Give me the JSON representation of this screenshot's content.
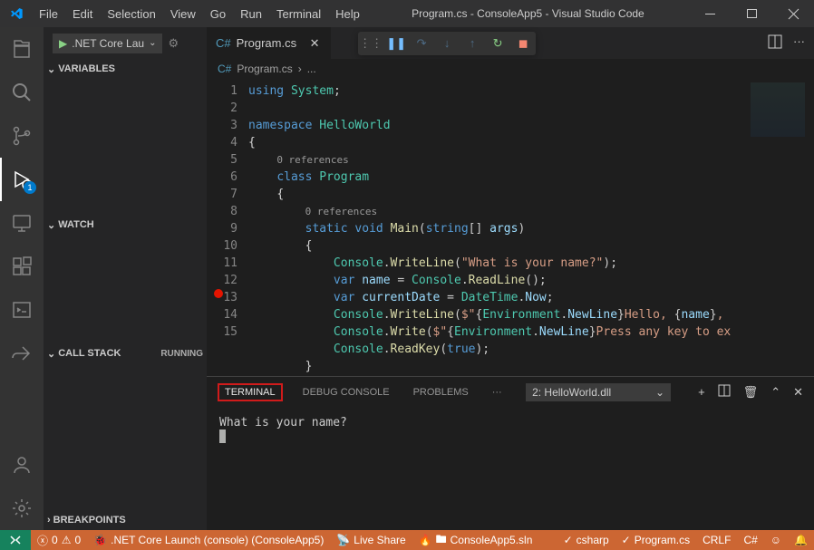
{
  "titlebar": {
    "menu": [
      "File",
      "Edit",
      "Selection",
      "View",
      "Go",
      "Run",
      "Terminal",
      "Help"
    ],
    "title": "Program.cs - ConsoleApp5 - Visual Studio Code"
  },
  "activitybar": {
    "debug_badge": "1"
  },
  "sidebar": {
    "run_config": ".NET Core Lau",
    "sections": {
      "variables": "VARIABLES",
      "watch": "WATCH",
      "callstack": "CALL STACK",
      "callstack_state": "RUNNING",
      "breakpoints": "BREAKPOINTS"
    }
  },
  "editor": {
    "tab_name": "Program.cs",
    "breadcrumb_file": "Program.cs",
    "breadcrumb_suffix": "...",
    "lines": [
      "1",
      "2",
      "3",
      "4",
      "",
      "5",
      "6",
      "",
      "7",
      "8",
      "9",
      "10",
      "11",
      "12",
      "13",
      "14",
      "15"
    ],
    "breakpoint_line": 12,
    "code": {
      "l1_using": "using",
      "l1_system": "System",
      "l3_namespace": "namespace",
      "l3_name": "HelloWorld",
      "codelens": "0 references",
      "l5_class": "class",
      "l5_name": "Program",
      "l7_static": "static",
      "l7_void": "void",
      "l7_main": "Main",
      "l7_string": "string",
      "l7_args": "args",
      "l9_console": "Console",
      "l9_wl": "WriteLine",
      "l9_str": "\"What is your name?\"",
      "l10_var": "var",
      "l10_name": "name",
      "l10_console": "Console",
      "l10_rl": "ReadLine",
      "l11_var": "var",
      "l11_cd": "currentDate",
      "l11_dt": "DateTime",
      "l11_now": "Now",
      "l12_console": "Console",
      "l12_wl": "WriteLine",
      "l12_str1": "$\"",
      "l12_env": "Environment",
      "l12_nl": "NewLine",
      "l12_str2": "Hello, ",
      "l12_name": "name",
      "l12_str3": ", ",
      "l13_console": "Console",
      "l13_w": "Write",
      "l13_str1": "$\"",
      "l13_env": "Environment",
      "l13_nl": "NewLine",
      "l13_str2": "Press any key to ex",
      "l14_console": "Console",
      "l14_rk": "ReadKey",
      "l14_true": "true"
    }
  },
  "panel": {
    "tabs": {
      "terminal": "TERMINAL",
      "debug": "DEBUG CONSOLE",
      "problems": "PROBLEMS"
    },
    "select": "2: HelloWorld.dll",
    "output": "What is your name?"
  },
  "statusbar": {
    "errors": "0",
    "warnings": "0",
    "launch": ".NET Core Launch (console) (ConsoleApp5)",
    "liveshare": "Live Share",
    "solution": "ConsoleApp5.sln",
    "csharp": "csharp",
    "program": "Program.cs",
    "eol": "CRLF",
    "lang": "C#",
    "feedback": "☺"
  }
}
